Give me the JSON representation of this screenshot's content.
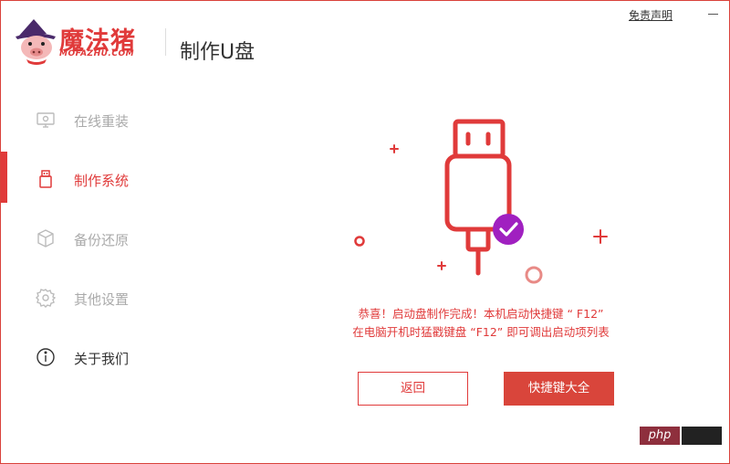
{
  "app": {
    "brand_cn": "魔法猪",
    "brand_en": "MOFAZHU.COM",
    "page_title": "制作U盘"
  },
  "header": {
    "disclaimer_label": "免责声明"
  },
  "sidebar": {
    "items": [
      {
        "label": "在线重装",
        "icon": "monitor-icon",
        "state": "inactive"
      },
      {
        "label": "制作系统",
        "icon": "usb-icon",
        "state": "active"
      },
      {
        "label": "备份还原",
        "icon": "cube-icon",
        "state": "inactive"
      },
      {
        "label": "其他设置",
        "icon": "gear-icon",
        "state": "inactive"
      },
      {
        "label": "关于我们",
        "icon": "info-icon",
        "state": "plain"
      }
    ]
  },
  "main": {
    "message_line1": "恭喜！启动盘制作完成！本机启动快捷键 “ F12”",
    "message_line2": "在电脑开机时猛戳键盘 “F12” 即可调出启动项列表",
    "back_label": "返回",
    "hotkeys_label": "快捷键大全"
  },
  "watermark": {
    "text": "php"
  },
  "colors": {
    "accent": "#e03a3a",
    "check_badge": "#a020c0",
    "inactive_text": "#aaaaaa",
    "plain_text": "#333333"
  }
}
